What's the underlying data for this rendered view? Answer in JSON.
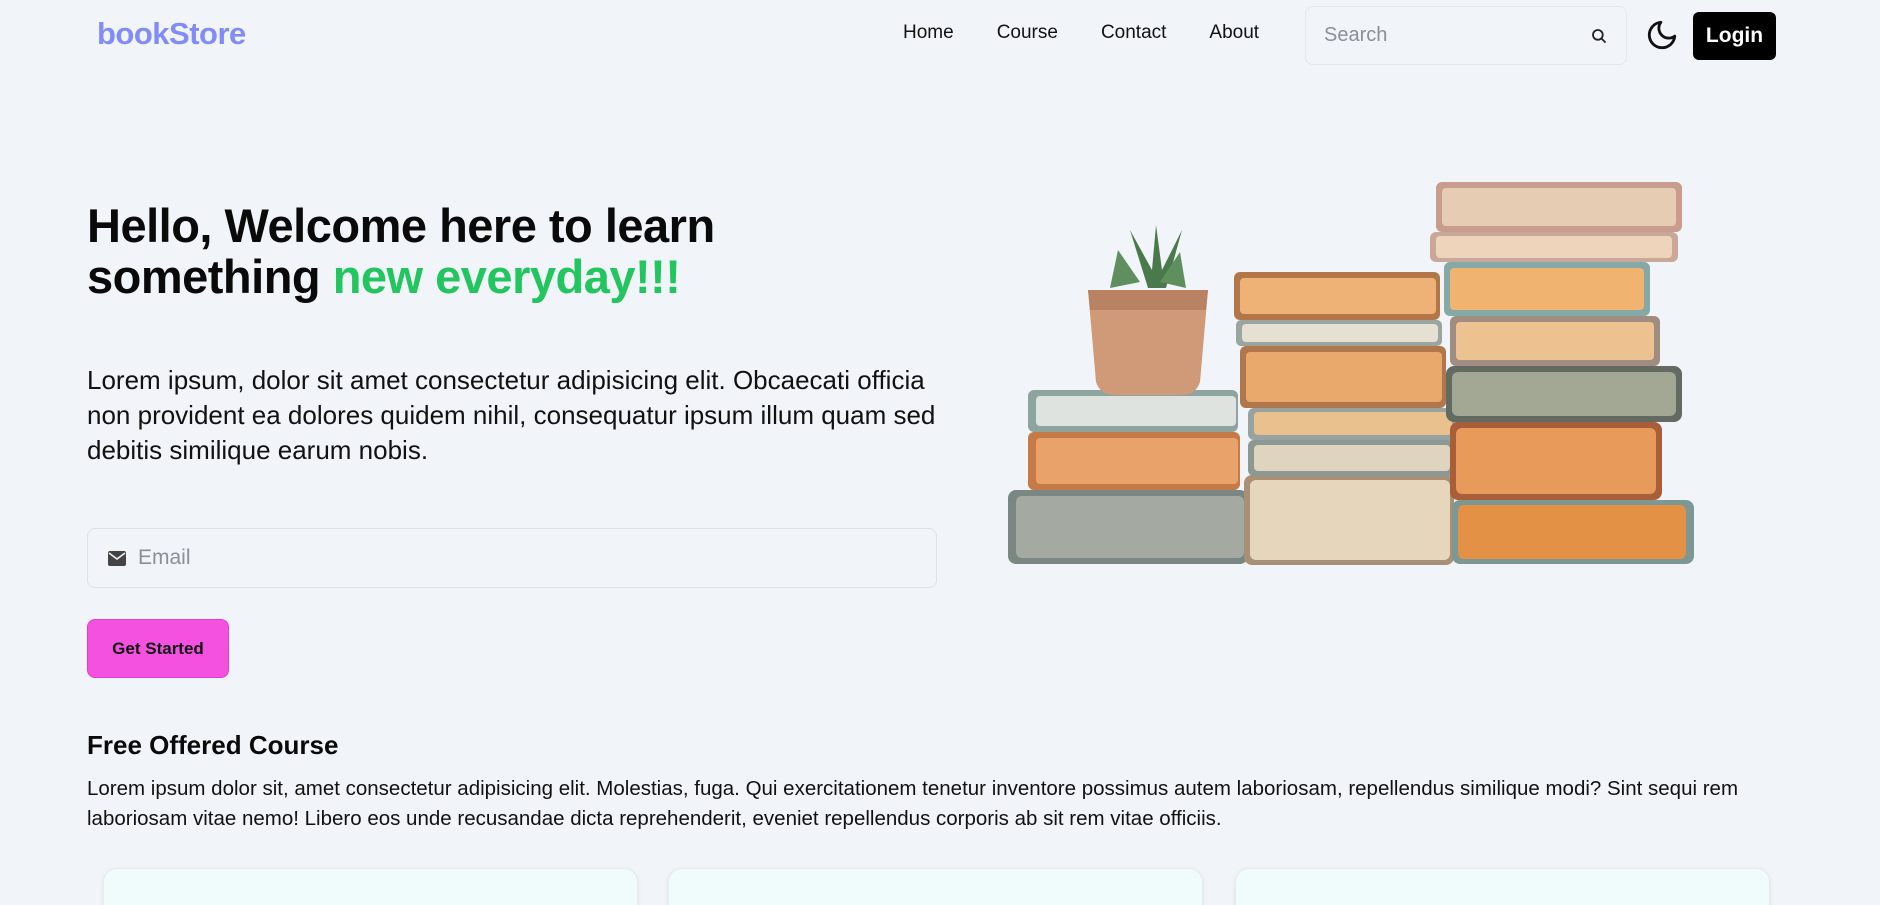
{
  "header": {
    "logo": "bookStore",
    "nav": [
      "Home",
      "Course",
      "Contact",
      "About"
    ],
    "search_placeholder": "Search",
    "login_label": "Login",
    "theme_icon": "moon-icon"
  },
  "hero": {
    "title_part1": "Hello, Welcome here to learn something ",
    "title_accent": "new everyday!!!",
    "description": "Lorem ipsum, dolor sit amet consectetur adipisicing elit. Obcaecati officia non provident ea dolores quidem nihil, consequatur ipsum illum quam sed debitis similique earum nobis.",
    "email_placeholder": "Email",
    "cta_label": "Get Started",
    "accent_color": "#22c55e"
  },
  "courses": {
    "title": "Free Offered Course",
    "description": "Lorem ipsum dolor sit, amet consectetur adipisicing elit. Molestias, fuga. Qui exercitationem tenetur inventore possimus autem laboriosam, repellendus similique modi? Sint sequi rem laboriosam vitae nemo! Libero eos unde recusandae dicta reprehenderit, eveniet repellendus corporis ab sit rem vitae officiis."
  },
  "colors": {
    "brand": "#818cf8",
    "cta": "#f451e0",
    "background": "#f1f5f9"
  }
}
